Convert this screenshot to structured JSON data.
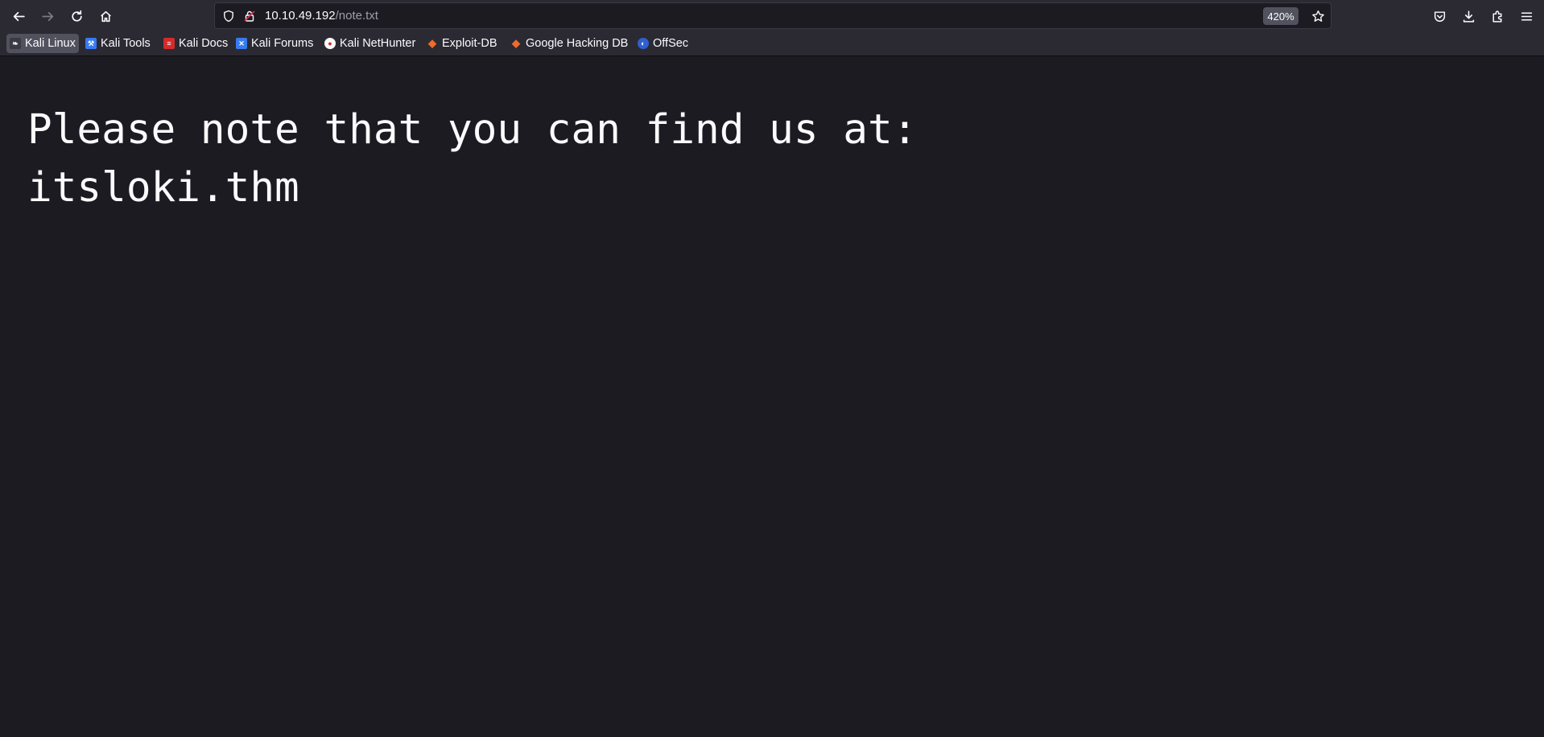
{
  "browser": {
    "url_host": "10.10.49.192",
    "url_path": "/note.txt",
    "zoom_level": "420%"
  },
  "bookmarks": [
    {
      "label": "Kali Linux",
      "icon": "kali-dragon-icon",
      "active": true
    },
    {
      "label": "Kali Tools",
      "icon": "kali-tools-icon"
    },
    {
      "label": "Kali Docs",
      "icon": "kali-docs-icon"
    },
    {
      "label": "Kali Forums",
      "icon": "kali-forums-icon"
    },
    {
      "label": "Kali NetHunter",
      "icon": "kali-nethunter-icon"
    },
    {
      "label": "Exploit-DB",
      "icon": "exploit-db-icon"
    },
    {
      "label": "Google Hacking DB",
      "icon": "exploit-db-icon"
    },
    {
      "label": "OffSec",
      "icon": "offsec-icon"
    }
  ],
  "page": {
    "text_line_1": "Please note that you can find us at:",
    "text_line_2": "itsloki.thm"
  },
  "colors": {
    "toolbar_bg": "#2b2a33",
    "page_bg": "#1c1b22",
    "text": "#fbfbfe"
  }
}
